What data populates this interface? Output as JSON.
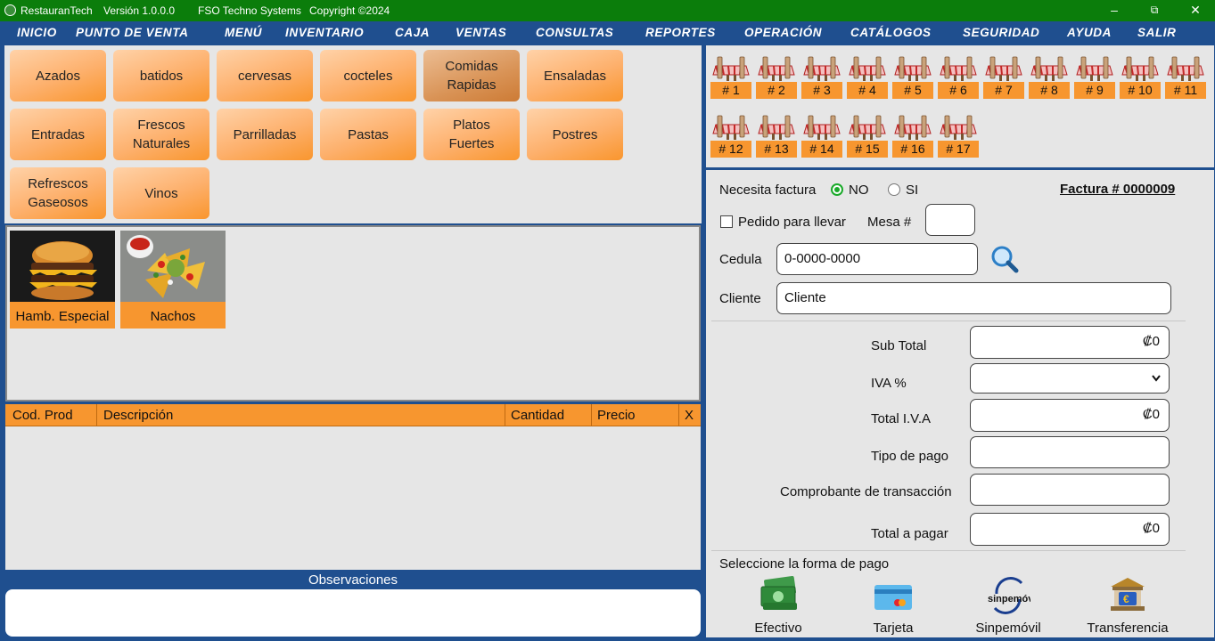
{
  "window": {
    "app_name": "RestauranTech",
    "version": "Versión  1.0.0.0",
    "company": "FSO Techno Systems",
    "copyright": "Copyright ©2024",
    "minimize": "–",
    "restore": "⧉",
    "close": "✕"
  },
  "menu": [
    "INICIO",
    "PUNTO DE VENTA",
    "MENÚ",
    "INVENTARIO",
    "CAJA",
    "VENTAS",
    "CONSULTAS",
    "REPORTES",
    "OPERACIÓN",
    "CATÁLOGOS",
    "SEGURIDAD",
    "AYUDA",
    "SALIR"
  ],
  "categories": [
    "Azados",
    "batidos",
    "cervesas",
    "cocteles",
    "Comidas\nRapidas",
    "Ensaladas",
    "Entradas",
    "Frescos\nNaturales",
    "Parrilladas",
    "Pastas",
    "Platos\nFuertes",
    "Postres",
    "Refrescos\nGaseosos",
    "Vinos"
  ],
  "selected_category": "Comidas\nRapidas",
  "products": [
    {
      "name": "Hamb. Especial",
      "icon": "burger-image"
    },
    {
      "name": "Nachos",
      "icon": "nachos-image"
    }
  ],
  "order_grid": {
    "columns": [
      "Cod. Prod",
      "Descripción",
      "Cantidad",
      "Precio",
      "X"
    ]
  },
  "observations": {
    "label": "Observaciones",
    "value": ""
  },
  "tables": [
    "# 1",
    "# 2",
    "# 3",
    "# 4",
    "# 5",
    "# 6",
    "# 7",
    "# 8",
    "# 9",
    "# 10",
    "# 11",
    "# 12",
    "# 13",
    "# 14",
    "# 15",
    "# 16",
    "# 17"
  ],
  "invoice": {
    "needs_invoice_label": "Necesita factura",
    "no_label": "NO",
    "yes_label": "SI",
    "selected": "NO",
    "invoice_number": "Factura # 0000009",
    "takeaway_label": "Pedido para llevar",
    "takeaway_checked": false,
    "table_label": "Mesa #",
    "table_value": "",
    "id_label": "Cedula",
    "id_value": "0-0000-0000",
    "client_label": "Cliente",
    "client_value": "Cliente"
  },
  "totals": {
    "subtotal_label": "Sub Total",
    "subtotal_value": "₡0",
    "iva_label": "IVA %",
    "iva_value": "",
    "total_iva_label": "Total I.V.A",
    "total_iva_value": "₡0",
    "payment_type_label": "Tipo de pago",
    "payment_type_value": "",
    "receipt_label": "Comprobante de transacción",
    "receipt_value": "",
    "total_label": "Total a pagar",
    "total_value": "₡0"
  },
  "payment": {
    "prompt": "Seleccione la forma de pago",
    "methods": [
      {
        "label": "Efectivo",
        "icon": "cash-icon"
      },
      {
        "label": "Tarjeta",
        "icon": "card-icon"
      },
      {
        "label": "Sinpemóvil",
        "icon": "sinpe-icon",
        "logo_text": "sinpemóvil"
      },
      {
        "label": "Transferencia",
        "icon": "bank-transfer-icon"
      }
    ]
  },
  "colors": {
    "titlebar": "#0b7d0b",
    "menubar": "#1f4f8f",
    "accent_orange": "#f7962f",
    "panel_bg": "#e6e6e6",
    "radio_green": "#1aaa2a"
  }
}
